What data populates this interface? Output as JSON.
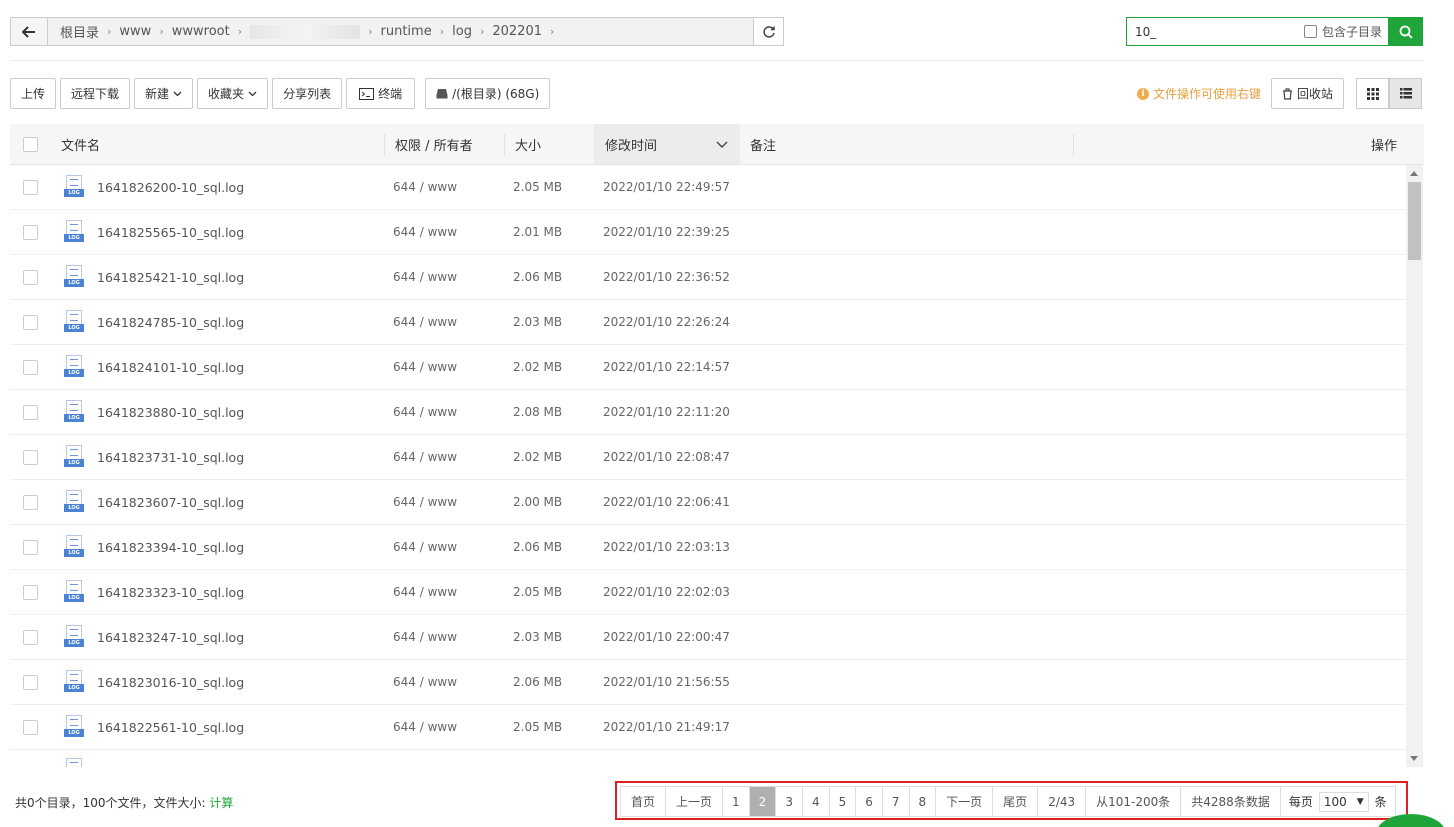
{
  "breadcrumb": {
    "items": [
      "根目录",
      "www",
      "wwwroot",
      "runtime",
      "log",
      "202201"
    ]
  },
  "search": {
    "value": "10_",
    "subdir_label": "包含子目录"
  },
  "toolbar": {
    "upload": "上传",
    "remote_download": "远程下载",
    "new": "新建",
    "favorites": "收藏夹",
    "share_list": "分享列表",
    "terminal": "终端",
    "disk": "/(根目录) (68G)",
    "tip": "文件操作可使用右键",
    "recycle": "回收站"
  },
  "table": {
    "headers": {
      "name": "文件名",
      "perm": "权限 / 所有者",
      "size": "大小",
      "mtime": "修改时间",
      "remark": "备注",
      "ops": "操作"
    },
    "rows": [
      {
        "name": "1641826200-10_sql.log",
        "perm": "644 / www",
        "size": "2.05 MB",
        "mtime": "2022/01/10 22:49:57"
      },
      {
        "name": "1641825565-10_sql.log",
        "perm": "644 / www",
        "size": "2.01 MB",
        "mtime": "2022/01/10 22:39:25"
      },
      {
        "name": "1641825421-10_sql.log",
        "perm": "644 / www",
        "size": "2.06 MB",
        "mtime": "2022/01/10 22:36:52"
      },
      {
        "name": "1641824785-10_sql.log",
        "perm": "644 / www",
        "size": "2.03 MB",
        "mtime": "2022/01/10 22:26:24"
      },
      {
        "name": "1641824101-10_sql.log",
        "perm": "644 / www",
        "size": "2.02 MB",
        "mtime": "2022/01/10 22:14:57"
      },
      {
        "name": "1641823880-10_sql.log",
        "perm": "644 / www",
        "size": "2.08 MB",
        "mtime": "2022/01/10 22:11:20"
      },
      {
        "name": "1641823731-10_sql.log",
        "perm": "644 / www",
        "size": "2.02 MB",
        "mtime": "2022/01/10 22:08:47"
      },
      {
        "name": "1641823607-10_sql.log",
        "perm": "644 / www",
        "size": "2.00 MB",
        "mtime": "2022/01/10 22:06:41"
      },
      {
        "name": "1641823394-10_sql.log",
        "perm": "644 / www",
        "size": "2.06 MB",
        "mtime": "2022/01/10 22:03:13"
      },
      {
        "name": "1641823323-10_sql.log",
        "perm": "644 / www",
        "size": "2.05 MB",
        "mtime": "2022/01/10 22:02:03"
      },
      {
        "name": "1641823247-10_sql.log",
        "perm": "644 / www",
        "size": "2.03 MB",
        "mtime": "2022/01/10 22:00:47"
      },
      {
        "name": "1641823016-10_sql.log",
        "perm": "644 / www",
        "size": "2.06 MB",
        "mtime": "2022/01/10 21:56:55"
      },
      {
        "name": "1641822561-10_sql.log",
        "perm": "644 / www",
        "size": "2.05 MB",
        "mtime": "2022/01/10 21:49:17"
      }
    ]
  },
  "footer": {
    "summary": "共0个目录，100个文件，文件大小:",
    "calc": "计算"
  },
  "pager": {
    "first": "首页",
    "prev": "上一页",
    "pages": [
      "1",
      "2",
      "3",
      "4",
      "5",
      "6",
      "7",
      "8"
    ],
    "current": "2",
    "next": "下一页",
    "last": "尾页",
    "page_info": "2/43",
    "range": "从101-200条",
    "total": "共4288条数据",
    "per_page_label": "每页",
    "per_page_value": "100",
    "per_page_unit": "条"
  },
  "colors": {
    "accent": "#20a53a",
    "highlight_border": "#e02020",
    "tip": "#e6a23c"
  }
}
